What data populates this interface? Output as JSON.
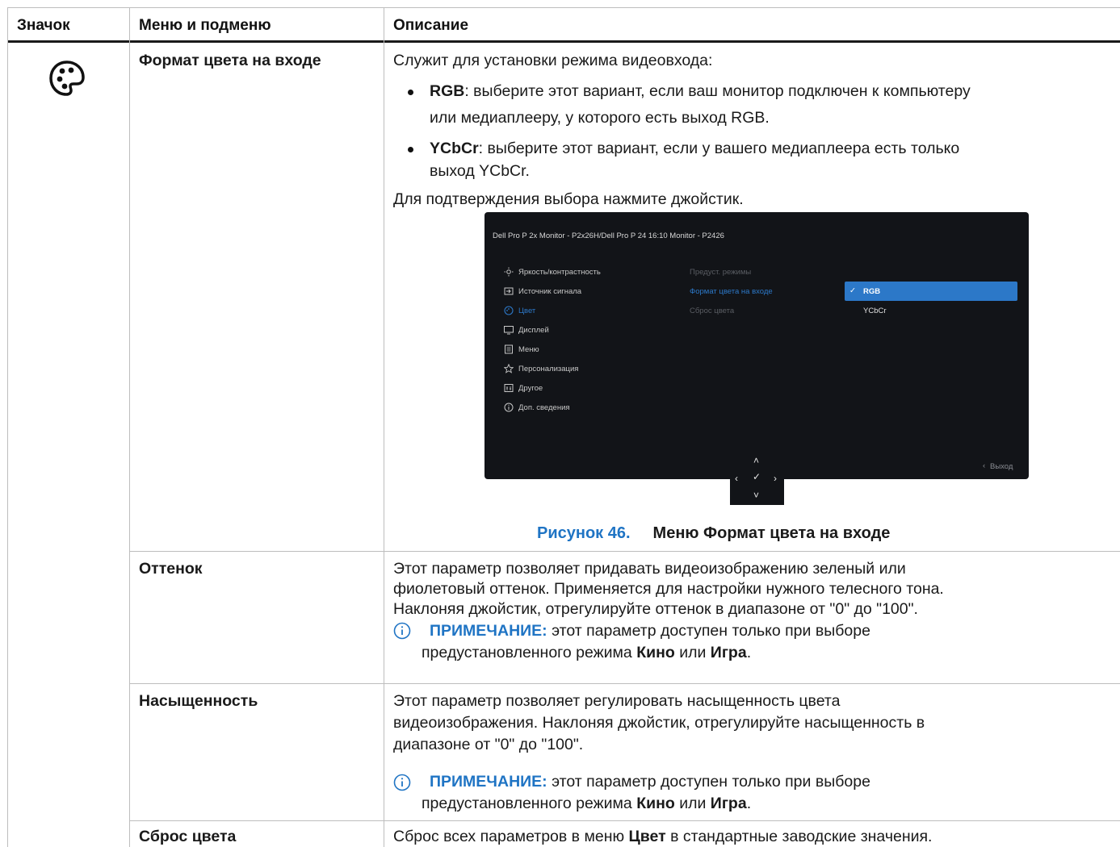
{
  "header": {
    "col_icon": "Значок",
    "col_menu": "Меню и подменю",
    "col_desc": "Описание"
  },
  "rows": {
    "input_color": {
      "menu": "Формат цвета на входе",
      "intro": "Служит для установки режима видеовхода:",
      "bullet1_term": "RGB",
      "bullet1_line1": ": выберите этот вариант, если ваш монитор подключен к компьютеру",
      "bullet1_line2": "или медиаплееру, у которого есть выход RGB.",
      "bullet2_term": "YCbCr",
      "bullet2_line1": ": выберите этот вариант, если у вашего медиаплеера есть только",
      "bullet2_line2": "выход YCbCr.",
      "confirm": "Для подтверждения выбора нажмите джойстик.",
      "figure_num": "Рисунок 46.",
      "figure_title": "Меню Формат цвета на входе"
    },
    "hue": {
      "menu": "Оттенок",
      "line1": "Этот параметр позволяет придавать видеоизображению зеленый или",
      "line2": "фиолетовый оттенок. Применяется для настройки нужного телесного тона.",
      "line3": "Наклоняя джойстик, отрегулируйте оттенок в диапазоне от \"0\" до \"100\".",
      "note_label": "ПРИМЕЧАНИЕ:",
      "note_line1": " этот параметр доступен только при выборе",
      "note_line2a": "предустановленного режима ",
      "note_kino": "Кино",
      "note_or": " или ",
      "note_game": "Игра",
      "note_end": "."
    },
    "saturation": {
      "menu": "Насыщенность",
      "line1": "Этот параметр позволяет регулировать насыщенность цвета",
      "line2": "видеоизображения. Наклоняя джойстик, отрегулируйте насыщенность в",
      "line3": "диапазоне от \"0\" до \"100\".",
      "note_label": "ПРИМЕЧАНИЕ:",
      "note_line1": " этот параметр доступен только при выборе",
      "note_line2a": "предустановленного режима ",
      "note_kino": "Кино",
      "note_or": " или ",
      "note_game": "Игра",
      "note_end": "."
    },
    "reset": {
      "menu": "Сброс цвета",
      "desc_a": "Сброс всех параметров в меню ",
      "desc_b": "Цвет",
      "desc_c": " в стандартные заводские значения."
    }
  },
  "osd": {
    "title": "Dell Pro P 2x Monitor - P2x26H/Dell Pro P 24 16:10 Monitor - P2426",
    "menu": [
      "Яркость/контрастность",
      "Источник сигнала",
      "Цвет",
      "Дисплей",
      "Меню",
      "Персонализация",
      "Другое",
      "Доп. сведения"
    ],
    "sub": [
      "Предуст. режимы",
      "Формат цвета на входе",
      "Сброс цвета"
    ],
    "options": [
      "RGB",
      "YCbCr"
    ],
    "exit": "Выход",
    "accent": "#2c78c8"
  },
  "colors": {
    "figure_blue": "#1f74c4",
    "note_blue": "#1f74c4"
  }
}
